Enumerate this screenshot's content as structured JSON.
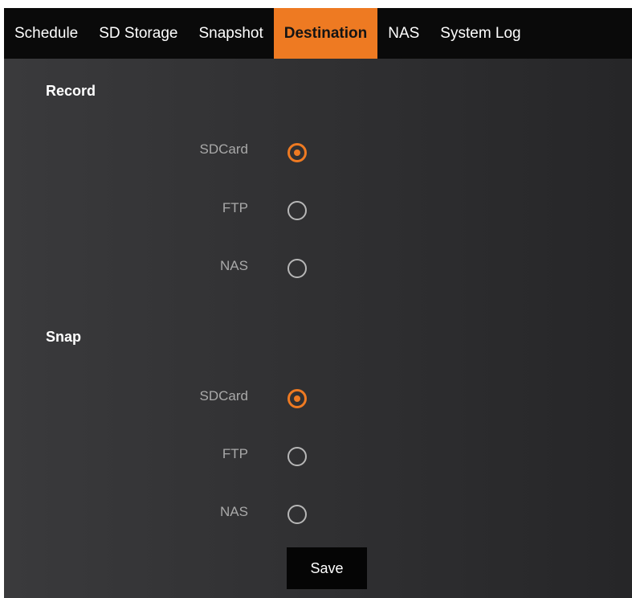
{
  "tabs": [
    {
      "label": "Schedule",
      "active": false
    },
    {
      "label": "SD Storage",
      "active": false
    },
    {
      "label": "Snapshot",
      "active": false
    },
    {
      "label": "Destination",
      "active": true
    },
    {
      "label": "NAS",
      "active": false
    },
    {
      "label": "System Log",
      "active": false
    }
  ],
  "record": {
    "title": "Record",
    "options": [
      {
        "label": "SDCard",
        "checked": true
      },
      {
        "label": "FTP",
        "checked": false
      },
      {
        "label": "NAS",
        "checked": false
      }
    ]
  },
  "snap": {
    "title": "Snap",
    "options": [
      {
        "label": "SDCard",
        "checked": true
      },
      {
        "label": "FTP",
        "checked": false
      },
      {
        "label": "NAS",
        "checked": false
      }
    ]
  },
  "save_label": "Save",
  "colors": {
    "accent": "#ee7a22",
    "tab_bar": "#0a0a0a",
    "panel": "#333335",
    "label_text": "#a9a9a9"
  }
}
